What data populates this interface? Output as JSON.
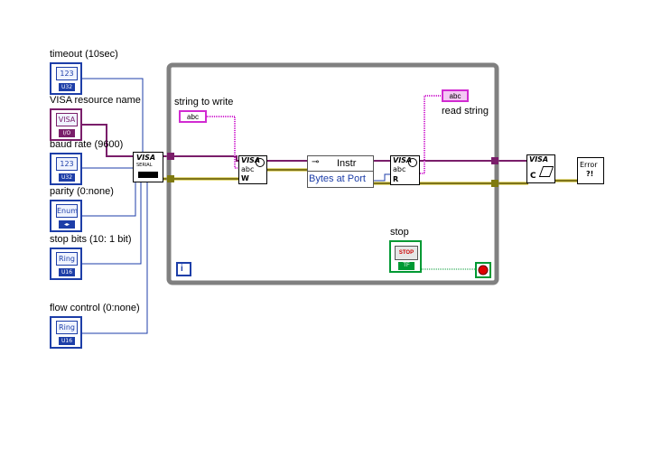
{
  "controls": {
    "timeout": {
      "label": "timeout (10sec)",
      "face": "123",
      "type": "U32"
    },
    "visa_resource": {
      "label": "VISA resource name",
      "face": "VISA",
      "type": "I/O"
    },
    "baud_rate": {
      "label": "baud rate (9600)",
      "face": "123",
      "type": "U32"
    },
    "parity": {
      "label": "parity (0:none)",
      "face": "Enum",
      "type": "◂▸"
    },
    "stop_bits": {
      "label": "stop bits (10: 1 bit)",
      "face": "Ring",
      "type": "U16"
    },
    "flow_control": {
      "label": "flow control (0:none)",
      "face": "Ring",
      "type": "U16"
    }
  },
  "loop": {
    "iteration_label": "i"
  },
  "string_to_write": {
    "label": "string to write",
    "const": "abc"
  },
  "read_string": {
    "label": "read string",
    "const": "abc"
  },
  "property_node": {
    "class": "Instr",
    "property": "Bytes at Port"
  },
  "visa_serial": {
    "label": "VISA",
    "sub": "SERIAL"
  },
  "visa_write": {
    "label": "VISA",
    "sub": "abc",
    "mode": "W"
  },
  "visa_read": {
    "label": "VISA",
    "sub": "abc",
    "mode": "R"
  },
  "visa_close": {
    "label": "VISA",
    "sub": "C"
  },
  "error_handler": {
    "label": "Error",
    "sub": "?!"
  },
  "stop": {
    "label": "stop",
    "button": "STOP",
    "type": "TF"
  },
  "colors": {
    "loop": "#808080",
    "visa_wire": "#7a1e6a",
    "error_wire": "#c9b400",
    "numeric_wire": "#1d3ea8",
    "string_wire": "#d12bd1",
    "bool_wire": "#009933"
  }
}
